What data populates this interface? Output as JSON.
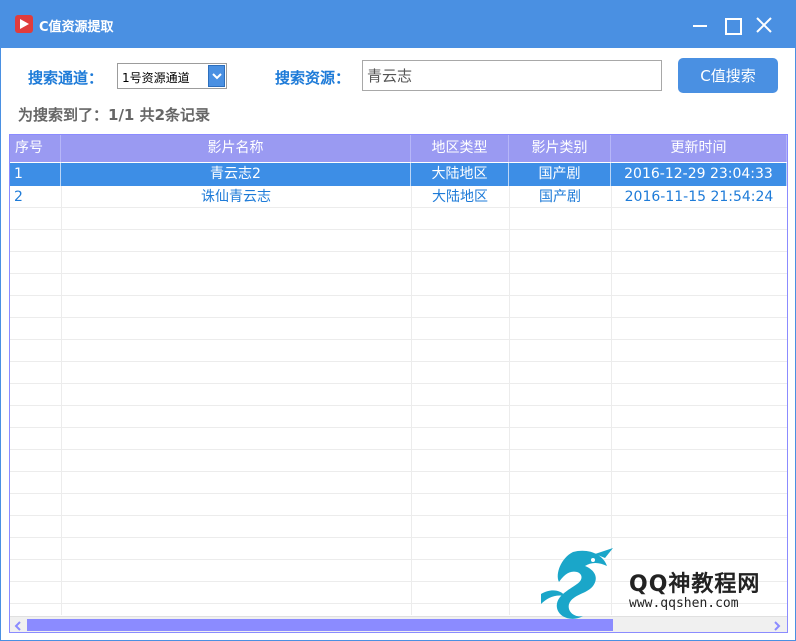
{
  "window": {
    "title": "C值资源提取",
    "accent": "#4a90e2"
  },
  "form": {
    "channel_label": "搜索通道：",
    "channel_value": "1号资源通道",
    "resource_label": "搜索资源：",
    "search_value": "青云志",
    "search_button": "C值搜索"
  },
  "status_text": "为搜索到了：1/1 共2条记录",
  "table": {
    "columns": [
      "序号",
      "影片名称",
      "地区类型",
      "影片类别",
      "更新时间"
    ],
    "rows": [
      {
        "index": "1",
        "name": "青云志2",
        "region": "大陆地区",
        "category": "国产剧",
        "updated": "2016-12-29 23:04:33",
        "selected": true
      },
      {
        "index": "2",
        "name": "诛仙青云志",
        "region": "大陆地区",
        "category": "国产剧",
        "updated": "2016-11-15 21:54:24",
        "selected": false
      }
    ]
  },
  "watermark": {
    "text": "QQ神教程网",
    "url": "www.qqshen.com"
  }
}
